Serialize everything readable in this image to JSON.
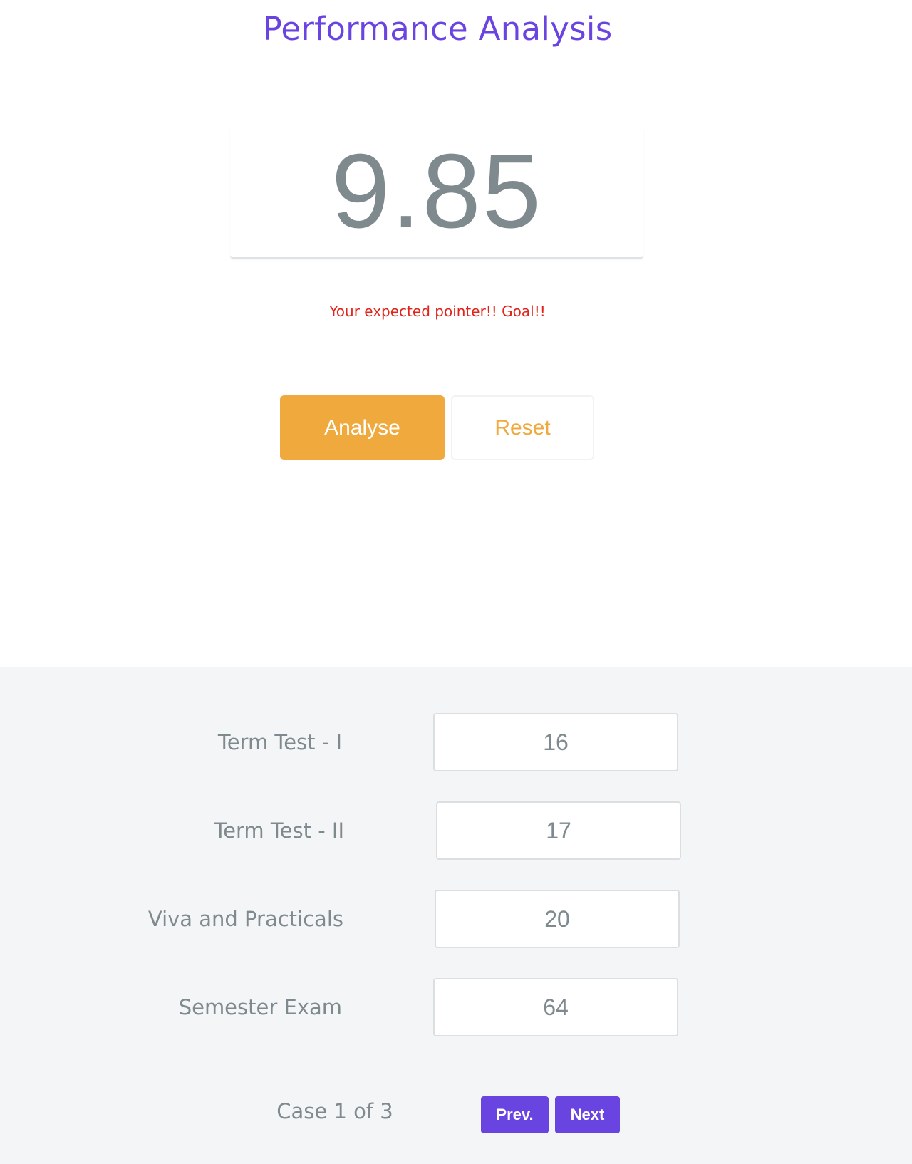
{
  "header": {
    "title": "Performance Analysis"
  },
  "result": {
    "score": "9.85",
    "message": "Your expected pointer!! Goal!!"
  },
  "actions": {
    "analyse_label": "Analyse",
    "reset_label": "Reset"
  },
  "fields": [
    {
      "label": "Term Test - I",
      "value": "16"
    },
    {
      "label": "Term Test - II",
      "value": "17"
    },
    {
      "label": "Viva and Practicals",
      "value": "20"
    },
    {
      "label": "Semester Exam",
      "value": "64"
    }
  ],
  "pagination": {
    "case_text": "Case 1 of 3",
    "prev_label": "Prev.",
    "next_label": "Next"
  },
  "colors": {
    "accent": "#6a44e0",
    "primary_button": "#f0a93d",
    "error_text": "#e0241b",
    "muted_text": "#7f8a8e",
    "section_background": "#f4f5f7"
  }
}
